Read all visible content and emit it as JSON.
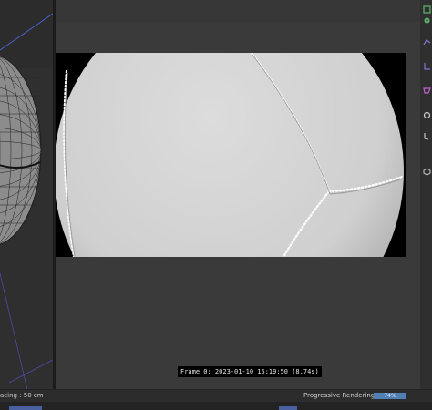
{
  "statusbar": {
    "grid_spacing": "acing : 50 cm",
    "rendering_status": "Progressive Rendering...",
    "progress_label": "74%",
    "progress_fraction": 0.74
  },
  "render_view": {
    "frame_info": "Frame  0:  2023-01-10  15:19:50  (8.74s)"
  },
  "toolbar": {
    "icons": [
      "cube-icon",
      "gear-icon",
      "spline-icon",
      "deformer-icon",
      "effector-icon",
      "tag-icon",
      "camera-icon"
    ]
  },
  "colors": {
    "accent": "#4f7fb3",
    "toolbar_icon": "#8a6fd6",
    "toolbar_icon_alt": "#5fb86a"
  }
}
